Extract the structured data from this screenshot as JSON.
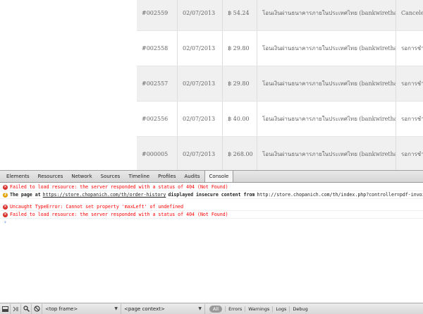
{
  "orders": [
    {
      "order": "#002559",
      "date": "02/07/2013",
      "total": "฿ 54.24",
      "payment": "โอนเงินผ่านธนาคารภายในประเทศไทย (bankwirethai)",
      "status": "Canceled"
    },
    {
      "order": "#002558",
      "date": "02/07/2013",
      "total": "฿ 29.80",
      "payment": "โอนเงินผ่านธนาคารภายในประเทศไทย (bankwirethai)",
      "status": "รอการชำระ"
    },
    {
      "order": "#002557",
      "date": "02/07/2013",
      "total": "฿ 29.80",
      "payment": "โอนเงินผ่านธนาคารภายในประเทศไทย (bankwirethai)",
      "status": "รอการชำระ"
    },
    {
      "order": "#002556",
      "date": "02/07/2013",
      "total": "฿ 40.00",
      "payment": "โอนเงินผ่านธนาคารภายในประเทศไทย (bankwirethai)",
      "status": "รอการชำระ"
    },
    {
      "order": "#000005",
      "date": "02/07/2013",
      "total": "฿ 268.00",
      "payment": "โอนเงินผ่านธนาคารภายในประเทศไทย (bankwirethai)",
      "status": "รอการชำระ"
    }
  ],
  "devtools": {
    "tabs": [
      "Elements",
      "Resources",
      "Network",
      "Sources",
      "Timeline",
      "Profiles",
      "Audits",
      "Console"
    ],
    "active_tab": "Console",
    "console": {
      "msg1": "Failed to load resource: the server responded with a status of 404 (Not Found)",
      "msg2_prefix": "The page at",
      "msg2_link": "https://store.chopanich.com/th/order-history",
      "msg2_middle": "displayed insecure content from",
      "msg2_url": "http://store.chopanich.com/th/index.php?controller=pdf-invoice",
      "msg3": "Uncaught TypeError: Cannot set property 'maxLeft' of undefined",
      "msg4": "Failed to load resource: the server responded with a status of 404 (Not Found)",
      "prompt": "›"
    },
    "statusbar": {
      "frame_select": "<top frame>",
      "context_select": "<page context>",
      "filter_all": "All",
      "filters": [
        "Errors",
        "Warnings",
        "Logs",
        "Debug"
      ]
    },
    "colors": {
      "error": "#ff0000",
      "error_icon": "#d9302c",
      "warning_icon": "#e5a200",
      "prompt": "#3b7de0"
    }
  }
}
